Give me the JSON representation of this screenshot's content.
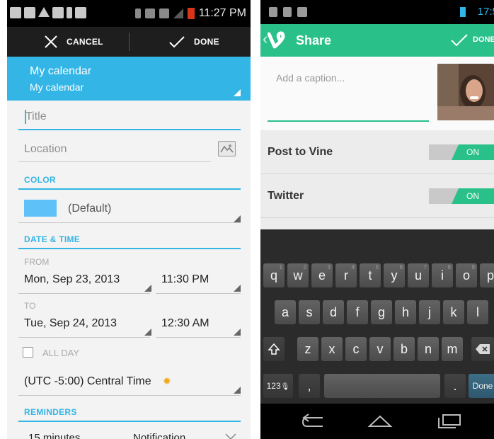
{
  "left": {
    "status": {
      "time": "11:27 PM"
    },
    "actionbar": {
      "cancel_label": "CANCEL",
      "done_label": "DONE"
    },
    "header": {
      "calendar": "My calendar",
      "account": "My calendar"
    },
    "title": {
      "placeholder": "Title"
    },
    "location": {
      "placeholder": "Location"
    },
    "color": {
      "section": "COLOR",
      "value": "(Default)",
      "swatch": "#5ec1f7"
    },
    "datetime": {
      "section": "DATE & TIME",
      "from_label": "FROM",
      "from_date": "Mon, Sep 23, 2013",
      "from_time": "11:30 PM",
      "to_label": "TO",
      "to_date": "Tue, Sep 24, 2013",
      "to_time": "12:30 AM",
      "all_day": "ALL DAY",
      "timezone": "(UTC -5:00) Central Time"
    },
    "reminders": {
      "section": "REMINDERS",
      "row": {
        "time": "15 minutes",
        "method": "Notification"
      }
    },
    "colors": {
      "accent": "#33b5e5",
      "actionbar": "#1e1e1e"
    }
  },
  "right": {
    "status": {
      "time": "17:5"
    },
    "actionbar": {
      "title": "Share",
      "done_label": "DONE"
    },
    "caption": {
      "placeholder": "Add a caption..."
    },
    "rows": [
      {
        "label": "Post to Vine",
        "toggle": "ON"
      },
      {
        "label": "Twitter",
        "toggle": "ON"
      }
    ],
    "keyboard": {
      "row1": [
        {
          "k": "q",
          "n": "1"
        },
        {
          "k": "w",
          "n": "2"
        },
        {
          "k": "e",
          "n": "3"
        },
        {
          "k": "r",
          "n": "4"
        },
        {
          "k": "t",
          "n": "5"
        },
        {
          "k": "y",
          "n": "6"
        },
        {
          "k": "u",
          "n": "7"
        },
        {
          "k": "i",
          "n": "8"
        },
        {
          "k": "o",
          "n": "9"
        },
        {
          "k": "p",
          "n": "0"
        }
      ],
      "row2": [
        "a",
        "s",
        "d",
        "f",
        "g",
        "h",
        "j",
        "k",
        "l"
      ],
      "row3": [
        "z",
        "x",
        "c",
        "v",
        "b",
        "n",
        "m"
      ],
      "symbols": "123",
      "comma": ",",
      "period": ".",
      "done": "Done"
    },
    "colors": {
      "accent": "#2ac08a"
    }
  }
}
